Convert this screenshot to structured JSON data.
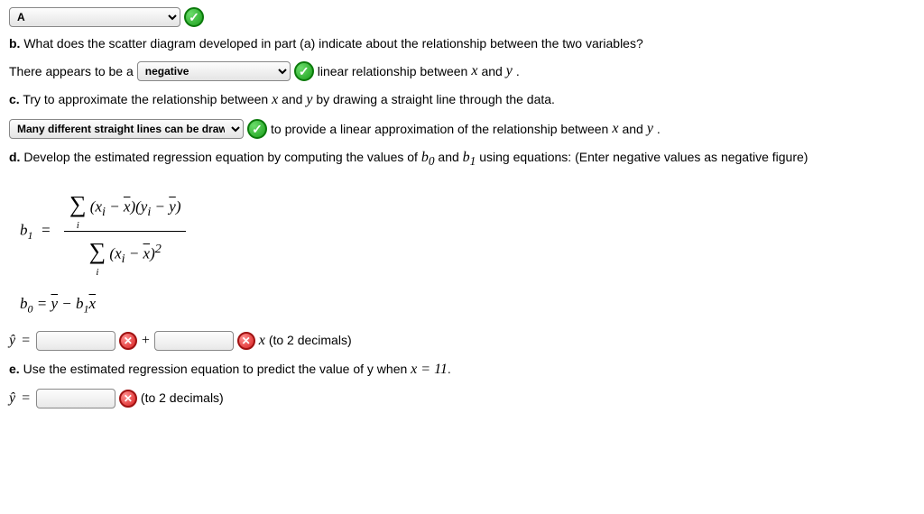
{
  "partA": {
    "dropdown_value": "A"
  },
  "partB": {
    "label": "b.",
    "question": "What does the scatter diagram developed in part (a) indicate about the relationship between the two variables?",
    "lead": "There appears to be a",
    "dropdown_value": "negative",
    "trail1": "linear relationship between",
    "var_x": "x",
    "and": "and",
    "var_y": "y",
    "period": "."
  },
  "partC": {
    "label": "c.",
    "question_1": "Try to approximate the relationship between",
    "question_2": "by drawing a straight line through the data.",
    "dropdown_value": "Many different straight lines can be drawn",
    "trail": "to provide a linear approximation of the relationship between"
  },
  "partD": {
    "label": "d.",
    "question_1": "Develop the estimated regression equation by computing the values of",
    "b0": "b",
    "sub0": "0",
    "b1": "b",
    "sub1": "1",
    "question_2": "using equations: (Enter negative values as negative figure)",
    "yhat": "ŷ",
    "eq": "=",
    "plus": "+",
    "trail": "(to 2 decimals)"
  },
  "partE": {
    "label": "e.",
    "question_1": "Use the estimated regression equation to predict the value of y when",
    "x_eq": "x = 11",
    "period": ".",
    "yhat": "ŷ",
    "eq": "=",
    "trail": "(to 2 decimals)"
  },
  "chart_data": null
}
